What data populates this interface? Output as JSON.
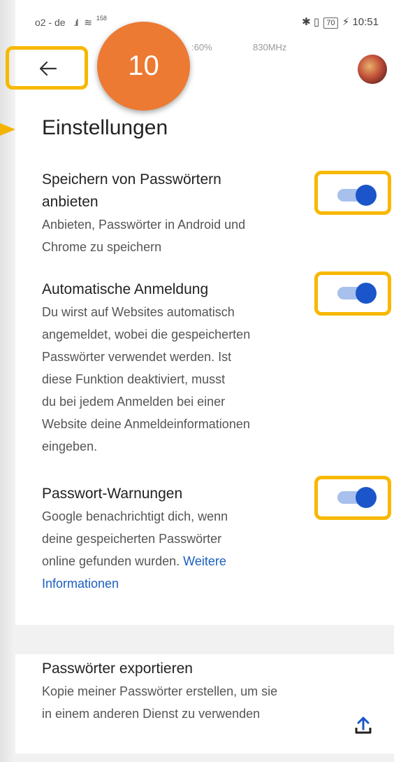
{
  "status_bar": {
    "carrier": "o2 - de",
    "network_speed": "158",
    "time": "10:51",
    "battery": "70"
  },
  "overlay_info": {
    "cpu": ":60%",
    "freq": "830MHz"
  },
  "step_badge": "10",
  "page_title": "Einstellungen",
  "settings": [
    {
      "title_line1": "Speichern von Passwörtern",
      "title_line2": "anbieten",
      "desc_line1": "Anbieten, Passwörter in Android und",
      "desc_line2": "Chrome zu speichern",
      "enabled": true
    },
    {
      "title": "Automatische Anmeldung",
      "desc_lines": [
        "Du wirst auf Websites automatisch",
        "angemeldet, wobei die gespeicherten",
        "Passwörter verwendet werden. Ist",
        "diese Funktion deaktiviert, musst",
        "du bei jedem Anmelden bei einer",
        "Website deine Anmeldeinformationen",
        "eingeben."
      ],
      "enabled": true
    },
    {
      "title": "Passwort-Warnungen",
      "desc_line1": "Google benachrichtigt dich, wenn",
      "desc_line2": "deine gespeicherten Passwörter",
      "desc_line3": "online gefunden wurden.",
      "link_part1": "Weitere",
      "link_part2": "Informationen",
      "enabled": true
    }
  ],
  "export": {
    "title": "Passwörter exportieren",
    "desc_line1": "Kopie meiner Passwörter erstellen, um sie",
    "desc_line2": "in einem anderen Dienst zu verwenden"
  },
  "colors": {
    "highlight": "#f7b800",
    "badge": "#ec7a33",
    "toggle_on": "#1a56c9",
    "link": "#1a5fc0"
  }
}
